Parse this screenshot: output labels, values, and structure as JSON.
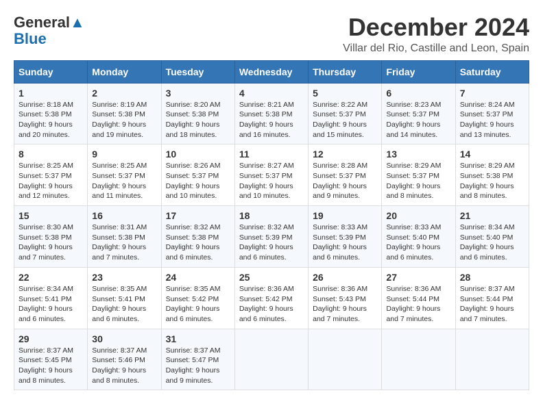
{
  "header": {
    "logo_line1": "General",
    "logo_line2": "Blue",
    "month_title": "December 2024",
    "location": "Villar del Rio, Castille and Leon, Spain"
  },
  "days_of_week": [
    "Sunday",
    "Monday",
    "Tuesday",
    "Wednesday",
    "Thursday",
    "Friday",
    "Saturday"
  ],
  "weeks": [
    [
      {
        "day": "1",
        "sunrise": "8:18 AM",
        "sunset": "5:38 PM",
        "daylight": "9 hours and 20 minutes."
      },
      {
        "day": "2",
        "sunrise": "8:19 AM",
        "sunset": "5:38 PM",
        "daylight": "9 hours and 19 minutes."
      },
      {
        "day": "3",
        "sunrise": "8:20 AM",
        "sunset": "5:38 PM",
        "daylight": "9 hours and 18 minutes."
      },
      {
        "day": "4",
        "sunrise": "8:21 AM",
        "sunset": "5:38 PM",
        "daylight": "9 hours and 16 minutes."
      },
      {
        "day": "5",
        "sunrise": "8:22 AM",
        "sunset": "5:37 PM",
        "daylight": "9 hours and 15 minutes."
      },
      {
        "day": "6",
        "sunrise": "8:23 AM",
        "sunset": "5:37 PM",
        "daylight": "9 hours and 14 minutes."
      },
      {
        "day": "7",
        "sunrise": "8:24 AM",
        "sunset": "5:37 PM",
        "daylight": "9 hours and 13 minutes."
      }
    ],
    [
      {
        "day": "8",
        "sunrise": "8:25 AM",
        "sunset": "5:37 PM",
        "daylight": "9 hours and 12 minutes."
      },
      {
        "day": "9",
        "sunrise": "8:25 AM",
        "sunset": "5:37 PM",
        "daylight": "9 hours and 11 minutes."
      },
      {
        "day": "10",
        "sunrise": "8:26 AM",
        "sunset": "5:37 PM",
        "daylight": "9 hours and 10 minutes."
      },
      {
        "day": "11",
        "sunrise": "8:27 AM",
        "sunset": "5:37 PM",
        "daylight": "9 hours and 10 minutes."
      },
      {
        "day": "12",
        "sunrise": "8:28 AM",
        "sunset": "5:37 PM",
        "daylight": "9 hours and 9 minutes."
      },
      {
        "day": "13",
        "sunrise": "8:29 AM",
        "sunset": "5:37 PM",
        "daylight": "9 hours and 8 minutes."
      },
      {
        "day": "14",
        "sunrise": "8:29 AM",
        "sunset": "5:38 PM",
        "daylight": "9 hours and 8 minutes."
      }
    ],
    [
      {
        "day": "15",
        "sunrise": "8:30 AM",
        "sunset": "5:38 PM",
        "daylight": "9 hours and 7 minutes."
      },
      {
        "day": "16",
        "sunrise": "8:31 AM",
        "sunset": "5:38 PM",
        "daylight": "9 hours and 7 minutes."
      },
      {
        "day": "17",
        "sunrise": "8:32 AM",
        "sunset": "5:38 PM",
        "daylight": "9 hours and 6 minutes."
      },
      {
        "day": "18",
        "sunrise": "8:32 AM",
        "sunset": "5:39 PM",
        "daylight": "9 hours and 6 minutes."
      },
      {
        "day": "19",
        "sunrise": "8:33 AM",
        "sunset": "5:39 PM",
        "daylight": "9 hours and 6 minutes."
      },
      {
        "day": "20",
        "sunrise": "8:33 AM",
        "sunset": "5:40 PM",
        "daylight": "9 hours and 6 minutes."
      },
      {
        "day": "21",
        "sunrise": "8:34 AM",
        "sunset": "5:40 PM",
        "daylight": "9 hours and 6 minutes."
      }
    ],
    [
      {
        "day": "22",
        "sunrise": "8:34 AM",
        "sunset": "5:41 PM",
        "daylight": "9 hours and 6 minutes."
      },
      {
        "day": "23",
        "sunrise": "8:35 AM",
        "sunset": "5:41 PM",
        "daylight": "9 hours and 6 minutes."
      },
      {
        "day": "24",
        "sunrise": "8:35 AM",
        "sunset": "5:42 PM",
        "daylight": "9 hours and 6 minutes."
      },
      {
        "day": "25",
        "sunrise": "8:36 AM",
        "sunset": "5:42 PM",
        "daylight": "9 hours and 6 minutes."
      },
      {
        "day": "26",
        "sunrise": "8:36 AM",
        "sunset": "5:43 PM",
        "daylight": "9 hours and 7 minutes."
      },
      {
        "day": "27",
        "sunrise": "8:36 AM",
        "sunset": "5:44 PM",
        "daylight": "9 hours and 7 minutes."
      },
      {
        "day": "28",
        "sunrise": "8:37 AM",
        "sunset": "5:44 PM",
        "daylight": "9 hours and 7 minutes."
      }
    ],
    [
      {
        "day": "29",
        "sunrise": "8:37 AM",
        "sunset": "5:45 PM",
        "daylight": "9 hours and 8 minutes."
      },
      {
        "day": "30",
        "sunrise": "8:37 AM",
        "sunset": "5:46 PM",
        "daylight": "9 hours and 8 minutes."
      },
      {
        "day": "31",
        "sunrise": "8:37 AM",
        "sunset": "5:47 PM",
        "daylight": "9 hours and 9 minutes."
      },
      null,
      null,
      null,
      null
    ]
  ]
}
